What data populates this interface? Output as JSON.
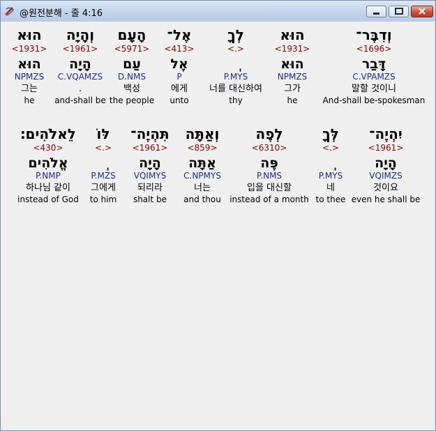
{
  "window": {
    "title": "@원전분해 - 줄 4:16",
    "controls": [
      "minimize-button",
      "maximize-button",
      "close-button"
    ]
  },
  "rows": [
    [
      {
        "heb": "וְדִבֶּר־",
        "num": "<1696>",
        "lemma": "דָּבַר",
        "morph": "C.VPAMZS",
        "kor": "말할 것이니",
        "eng": "And-shall be-spokesman",
        "highlight": true
      },
      {
        "heb": "הוּא",
        "num": "<1931>",
        "lemma": "הוּא",
        "morph": "NPMZS",
        "kor": "그가",
        "eng": "he"
      },
      {
        "heb": "לְךָ",
        "num": "<.>",
        "lemma": "ְ",
        "morph": "P.MYS",
        "kor": "너를 대신하여",
        "eng": "thy"
      },
      {
        "heb": "אֶל־",
        "num": "<413>",
        "lemma": "אֶל",
        "morph": "P",
        "kor": "에게",
        "eng": "unto"
      },
      {
        "heb": "הָעָם",
        "num": "<5971>",
        "lemma": "עַם",
        "morph": "D.NMS",
        "kor": "백성",
        "eng": "the people"
      },
      {
        "heb": "וְהָיָה",
        "num": "<1961>",
        "lemma": "הָיָה",
        "morph": "C.VQAMZS",
        "kor": ".",
        "eng": "and-shall be"
      },
      {
        "heb": "הוּא",
        "num": "<1931>",
        "lemma": "הוּא",
        "morph": "NPMZS",
        "kor": "그는",
        "eng": "he"
      }
    ],
    [
      {
        "heb": "יִהְיֶה־",
        "num": "<1961>",
        "lemma": "הָיָה",
        "morph": "VQIMZS",
        "kor": "것이요",
        "eng": "even he shall be"
      },
      {
        "heb": "לְּךָ",
        "num": "<.>",
        "lemma": "ְ",
        "morph": "P.MYS",
        "kor": "네",
        "eng": "to thee"
      },
      {
        "heb": "לְפֶה",
        "num": "<6310>",
        "lemma": "פֶּה",
        "morph": "P.NMS",
        "kor": "입을 대신할",
        "eng": "instead of a month"
      },
      {
        "heb": "וְאַתָּה",
        "num": "<859>",
        "lemma": "אַתָּה",
        "morph": "C.NPMYS",
        "kor": "너는",
        "eng": "and thou"
      },
      {
        "heb": "תִּהְיֶה־",
        "num": "<1961>",
        "lemma": "הָיָה",
        "morph": "VQIMYS",
        "kor": "되리라",
        "eng": "shalt be"
      },
      {
        "heb": "לּוֹ",
        "num": "<.>",
        "lemma": "ְ",
        "morph": "P.MZS",
        "kor": "그에게",
        "eng": "to him"
      },
      {
        "heb": "לֵאלֹהִים׃",
        "num": "<430>",
        "lemma": "אֱלֹהִים",
        "morph": "P.NMP",
        "kor": "하나님 같이",
        "eng": "instead of God"
      }
    ]
  ]
}
